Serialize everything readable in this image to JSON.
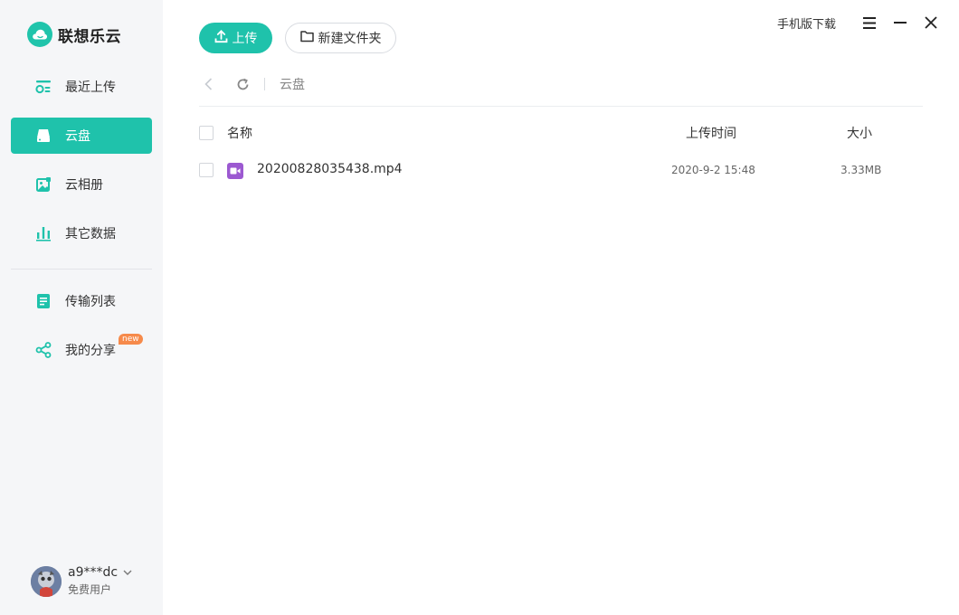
{
  "brand": {
    "name": "联想乐云"
  },
  "sidebar": {
    "items": [
      {
        "label": "最近上传",
        "icon": "recent-upload-icon"
      },
      {
        "label": "云盘",
        "icon": "cloud-drive-icon",
        "active": true
      },
      {
        "label": "云相册",
        "icon": "photo-album-icon"
      },
      {
        "label": "其它数据",
        "icon": "bar-chart-icon"
      },
      {
        "label": "传输列表",
        "icon": "transfer-list-icon"
      },
      {
        "label": "我的分享",
        "icon": "share-icon",
        "badge": "new"
      }
    ]
  },
  "user": {
    "name": "a9***dc",
    "tier": "免费用户"
  },
  "toolbar": {
    "upload_label": "上传",
    "new_folder_label": "新建文件夹"
  },
  "window": {
    "mobile_download": "手机版下载"
  },
  "path": {
    "crumb": "云盘"
  },
  "table": {
    "headers": {
      "name": "名称",
      "time": "上传时间",
      "size": "大小"
    },
    "rows": [
      {
        "name": "20200828035438.mp4",
        "time": "2020-9-2 15:48",
        "size": "3.33MB",
        "type": "video-file-icon"
      }
    ]
  },
  "colors": {
    "accent": "#1fc2ab",
    "badge": "#f68a4b",
    "video": "#9c59d1"
  }
}
